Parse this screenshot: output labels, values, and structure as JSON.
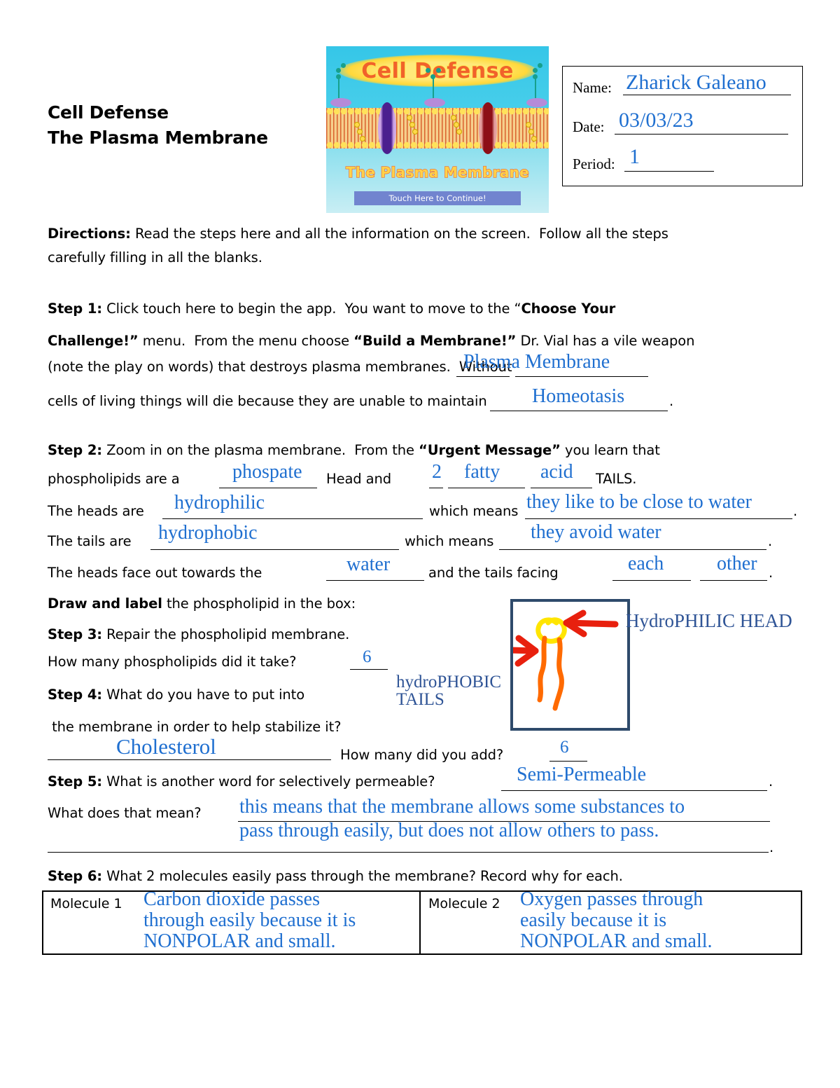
{
  "header": {
    "title_line1": "Cell Defense",
    "title_line2": "The Plasma Membrane",
    "splash": {
      "logo_text": "Cell Defense",
      "subtitle": "The Plasma Membrane",
      "button_label": "Touch Here to Continue!"
    },
    "name_box": {
      "name_label": "Name:",
      "name_value": "Zharick Galeano",
      "date_label": "Date:",
      "date_value": "03/03/23",
      "period_label": "Period:",
      "period_value": "1"
    }
  },
  "directions": {
    "label": "Directions:",
    "text_line1": " Read the steps here and all the information on the screen.  Follow all the steps",
    "text_line2": "carefully filling in all the blanks."
  },
  "step1": {
    "label": "Step 1:",
    "l1a": " Click touch here to begin the app.  You want to move to the “",
    "l1b": "Choose Your",
    "l2a": "Challenge!”",
    "l2b": " menu.  From the menu choose ",
    "l2c": "“Build a Membrane!”",
    "l2d": " Dr. Vial has a vile weapon",
    "l3": "(note the play on words) that destroys plasma membranes.  Without",
    "l4": "cells of living things will die because they are unable to maintain",
    "answer1": "Plasma Membrane",
    "answer2": "Homeotasis"
  },
  "step2": {
    "label": "Step 2:",
    "l1a": " Zoom in on the plasma membrane.  From the ",
    "l1b": "“Urgent Message”",
    "l1c": " you learn that",
    "l2a": "phospholipids are a",
    "l2b": "Head and",
    "l2c": "TAILS.",
    "a_phosphate": "phospate",
    "a_two": "2",
    "a_fatty": "fatty",
    "a_acid": "acid",
    "l3a": "The heads are",
    "l3b": "which means",
    "a_hydrophilic": "hydrophilic",
    "a_philic_means": "they like to be close to water",
    "l4a": "The tails are",
    "l4b": "which means",
    "a_hydrophobic": "hydrophobic",
    "a_phobic_means": "they avoid water",
    "l5a": "The heads face out towards the",
    "l5b": "and the tails facing",
    "a_water": "water",
    "a_each": "each",
    "a_other": "other"
  },
  "draw": {
    "label_bold": "Draw and label",
    "label_rest": " the phospholipid in the box:",
    "annotation_head": "HydroPHILIC HEAD",
    "annotation_tails_line1": "hydroPHOBIC",
    "annotation_tails_line2": "TAILS"
  },
  "step3": {
    "label": "Step 3:",
    "text": " Repair the phospholipid membrane.",
    "question": "How many phospholipids did it take?",
    "answer": "6"
  },
  "step4": {
    "label": "Step 4:",
    "text_line1": " What do you have to put into",
    "text_line2": " the membrane in order to help stabilize it?",
    "answer": "Cholesterol",
    "question2": "How many did you add?",
    "answer2": "6"
  },
  "step5": {
    "label": "Step 5:",
    "text": " What is another word for selectively permeable?",
    "answer": "Semi-Permeable",
    "question2": "What does that mean?",
    "answer2_line1": "this means that the membrane allows some substances to",
    "answer2_line2": "pass through easily, but does not allow others to pass."
  },
  "step6": {
    "label": "Step 6:",
    "text": " What 2 molecules easily pass through the membrane? Record why for each.",
    "molecule1_label": "Molecule 1",
    "molecule1_answer": "Carbon dioxide passes\nthrough easily because it is\nNONPOLAR and small.",
    "molecule2_label": "Molecule 2",
    "molecule2_answer": "Oxygen passes through\neasily because it is\nNONPOLAR and small."
  },
  "colors": {
    "handwriting_blue": "#1F6FD0",
    "annotation_blue": "#2F5496",
    "drawbox_border": "#2E4A6B",
    "arrow_red": "#E8200E",
    "head_yellow": "#FFE500",
    "tail_orange": "#FF6A00"
  }
}
